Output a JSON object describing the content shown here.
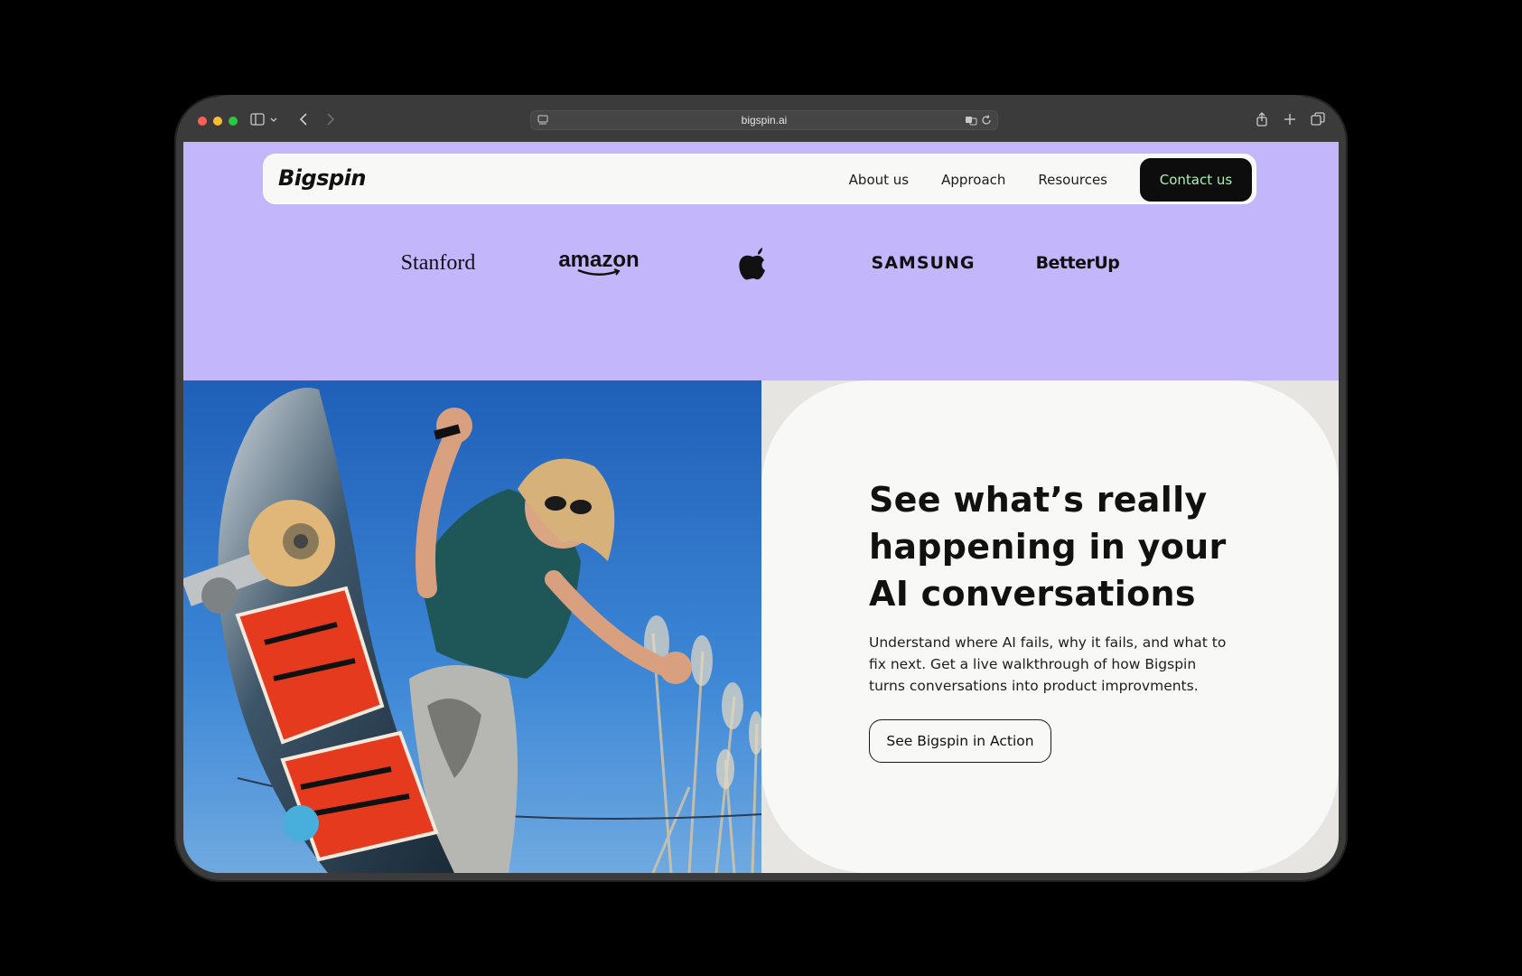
{
  "browser": {
    "url": "bigspin.ai",
    "traffic_lights": {
      "red": "#ff5f57",
      "yellow": "#febc2e",
      "green": "#28c840"
    }
  },
  "site": {
    "logo": "Bigspin",
    "nav": {
      "items": [
        {
          "label": "About us"
        },
        {
          "label": "Approach"
        },
        {
          "label": "Resources"
        }
      ],
      "cta": "Contact us"
    },
    "logos": {
      "stanford": "Stanford",
      "amazon": "amazon",
      "samsung": "SAMSUNG",
      "betterup": "BetterUp"
    },
    "hero": {
      "headline": "See what’s really happening in your AI conversations",
      "subtext": "Understand where AI fails, why it fails, and what to fix next. Get a live walkthrough of how Bigspin turns conversations into product improvments.",
      "cta": "See Bigspin in Action"
    }
  },
  "colors": {
    "hero_bg": "#c3b6fb",
    "nav_bg": "#f8f8f7",
    "contact_bg": "#0d0d0d",
    "contact_text": "#a8f0b0",
    "panel_bg": "#e6e5e1"
  }
}
